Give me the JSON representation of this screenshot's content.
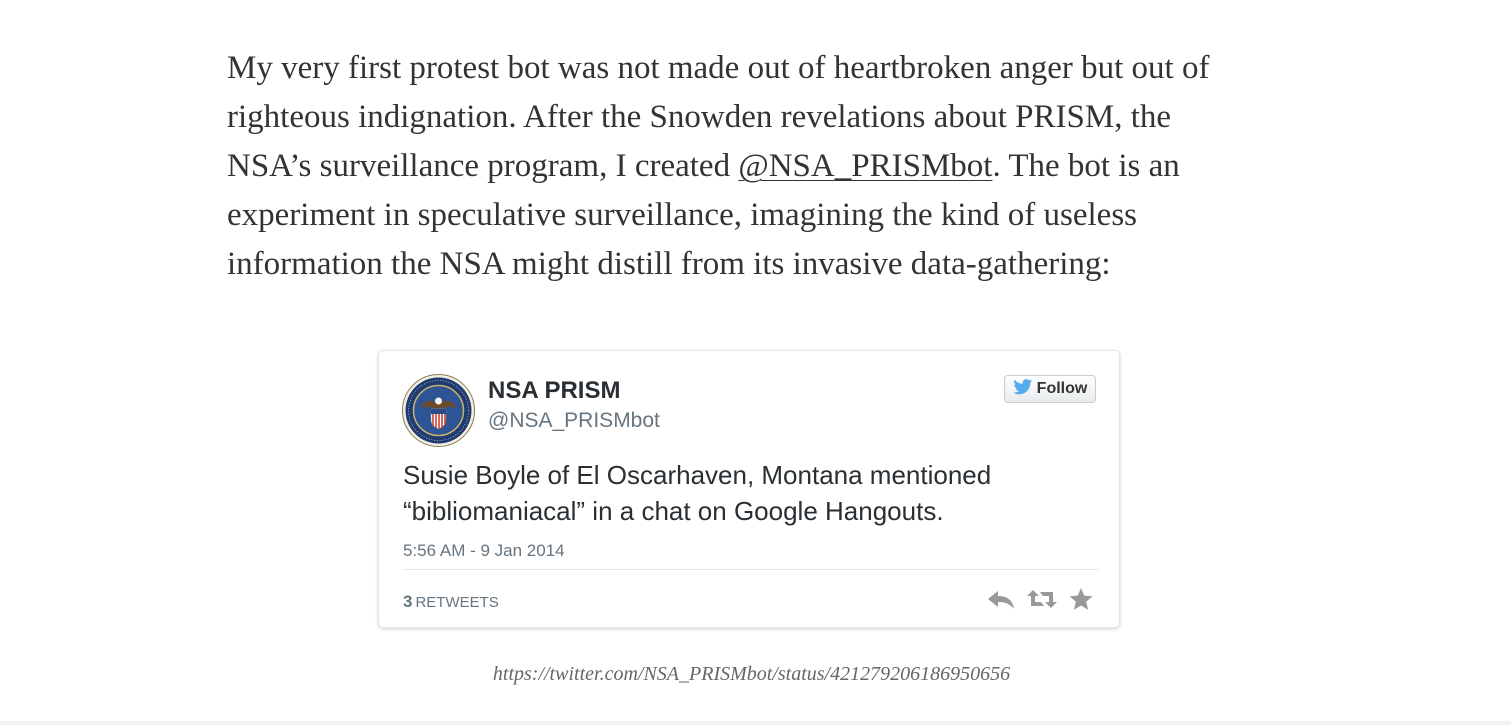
{
  "article": {
    "lines": [
      "My very first protest bot was not made out of heartbroken anger but out of",
      "righteous indignation. After the Snowden revelations about PRISM, the"
    ],
    "line3_before": "NSA’s surveillance program, I created ",
    "line3_link": "@NSA_PRISMbot",
    "line3_after": ". The bot is an",
    "line4": "experiment in speculative surveillance, imagining the kind of useless",
    "line5": "information the NSA might distill from its invasive data-gathering:"
  },
  "tweet": {
    "author_name": "NSA PRISM",
    "author_handle": "@NSA_PRISMbot",
    "follow_label": "Follow",
    "text_lines": [
      "Susie Boyle of El Oscarhaven, Montana mentioned",
      "“bibliomaniacal” in a chat on Google Hangouts."
    ],
    "timestamp": "5:56 AM - 9 Jan 2014",
    "retweet_count": "3",
    "retweet_label": "RETWEETS",
    "actions": [
      "reply-icon",
      "retweet-icon",
      "favorite-icon"
    ]
  },
  "caption": "https://twitter.com/NSA_PRISMbot/status/421279206186950656",
  "colors": {
    "body_text": "#333333",
    "tweet_text": "#292f33",
    "muted": "#66757f",
    "twitter_blue": "#55acee",
    "seal_blue": "#1f3b73",
    "icon_gray": "#999999"
  }
}
